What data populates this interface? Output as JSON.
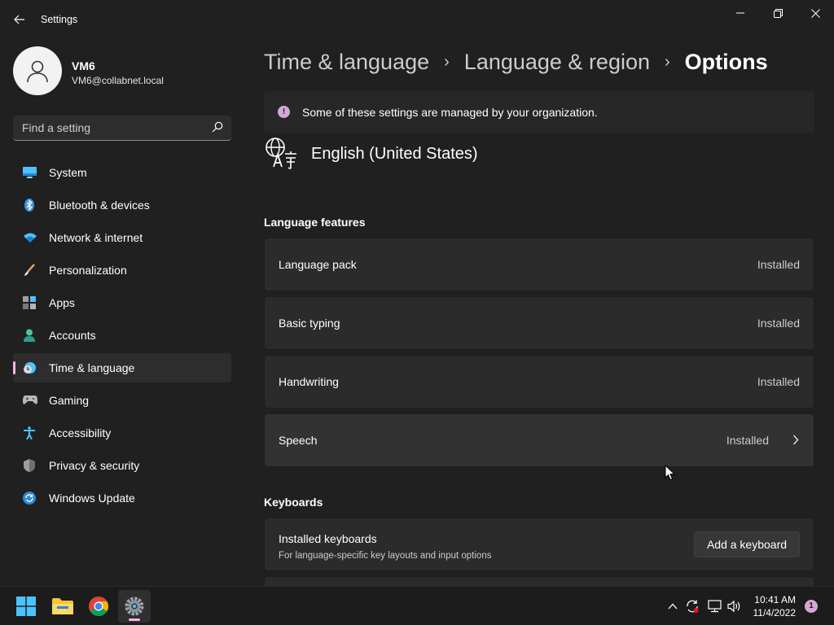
{
  "window": {
    "title": "Settings",
    "controls": {
      "minimize": "minimize-icon",
      "maximize": "restore-icon",
      "close": "close-icon"
    }
  },
  "profile": {
    "name": "VM6",
    "email": "VM6@collabnet.local"
  },
  "search": {
    "placeholder": "Find a setting"
  },
  "sidebar": {
    "items": [
      {
        "label": "System",
        "icon": "system-monitor-icon"
      },
      {
        "label": "Bluetooth & devices",
        "icon": "bluetooth-icon"
      },
      {
        "label": "Network & internet",
        "icon": "wifi-icon"
      },
      {
        "label": "Personalization",
        "icon": "brush-icon"
      },
      {
        "label": "Apps",
        "icon": "apps-icon"
      },
      {
        "label": "Accounts",
        "icon": "account-icon"
      },
      {
        "label": "Time & language",
        "icon": "globe-clock-icon",
        "selected": true
      },
      {
        "label": "Gaming",
        "icon": "controller-icon"
      },
      {
        "label": "Accessibility",
        "icon": "accessibility-icon"
      },
      {
        "label": "Privacy & security",
        "icon": "shield-icon"
      },
      {
        "label": "Windows Update",
        "icon": "update-icon"
      }
    ]
  },
  "breadcrumb": {
    "level1": "Time & language",
    "level2": "Language & region",
    "current": "Options",
    "separator": "›"
  },
  "banner": {
    "text": "Some of these settings are managed by your organization."
  },
  "language": {
    "name": "English (United States)"
  },
  "language_features": {
    "title": "Language features",
    "items": [
      {
        "label": "Language pack",
        "status": "Installed"
      },
      {
        "label": "Basic typing",
        "status": "Installed"
      },
      {
        "label": "Handwriting",
        "status": "Installed"
      },
      {
        "label": "Speech",
        "status": "Installed",
        "expandable": true
      }
    ]
  },
  "keyboards": {
    "title": "Keyboards",
    "installed": {
      "label": "Installed keyboards",
      "description": "For language-specific key layouts and input options",
      "button": "Add a keyboard"
    }
  },
  "taskbar": {
    "apps": [
      "start-icon",
      "file-explorer-icon",
      "chrome-icon",
      "settings-icon"
    ],
    "tray": [
      "chevron-up-icon",
      "sync-icon",
      "network-icon",
      "volume-icon"
    ],
    "time": "10:41 AM",
    "date": "11/4/2022",
    "notification_count": "1"
  },
  "colors": {
    "accent": "#ffb2e6",
    "info": "#d7a6d8",
    "background": "#202020",
    "card": "#2b2b2b"
  }
}
